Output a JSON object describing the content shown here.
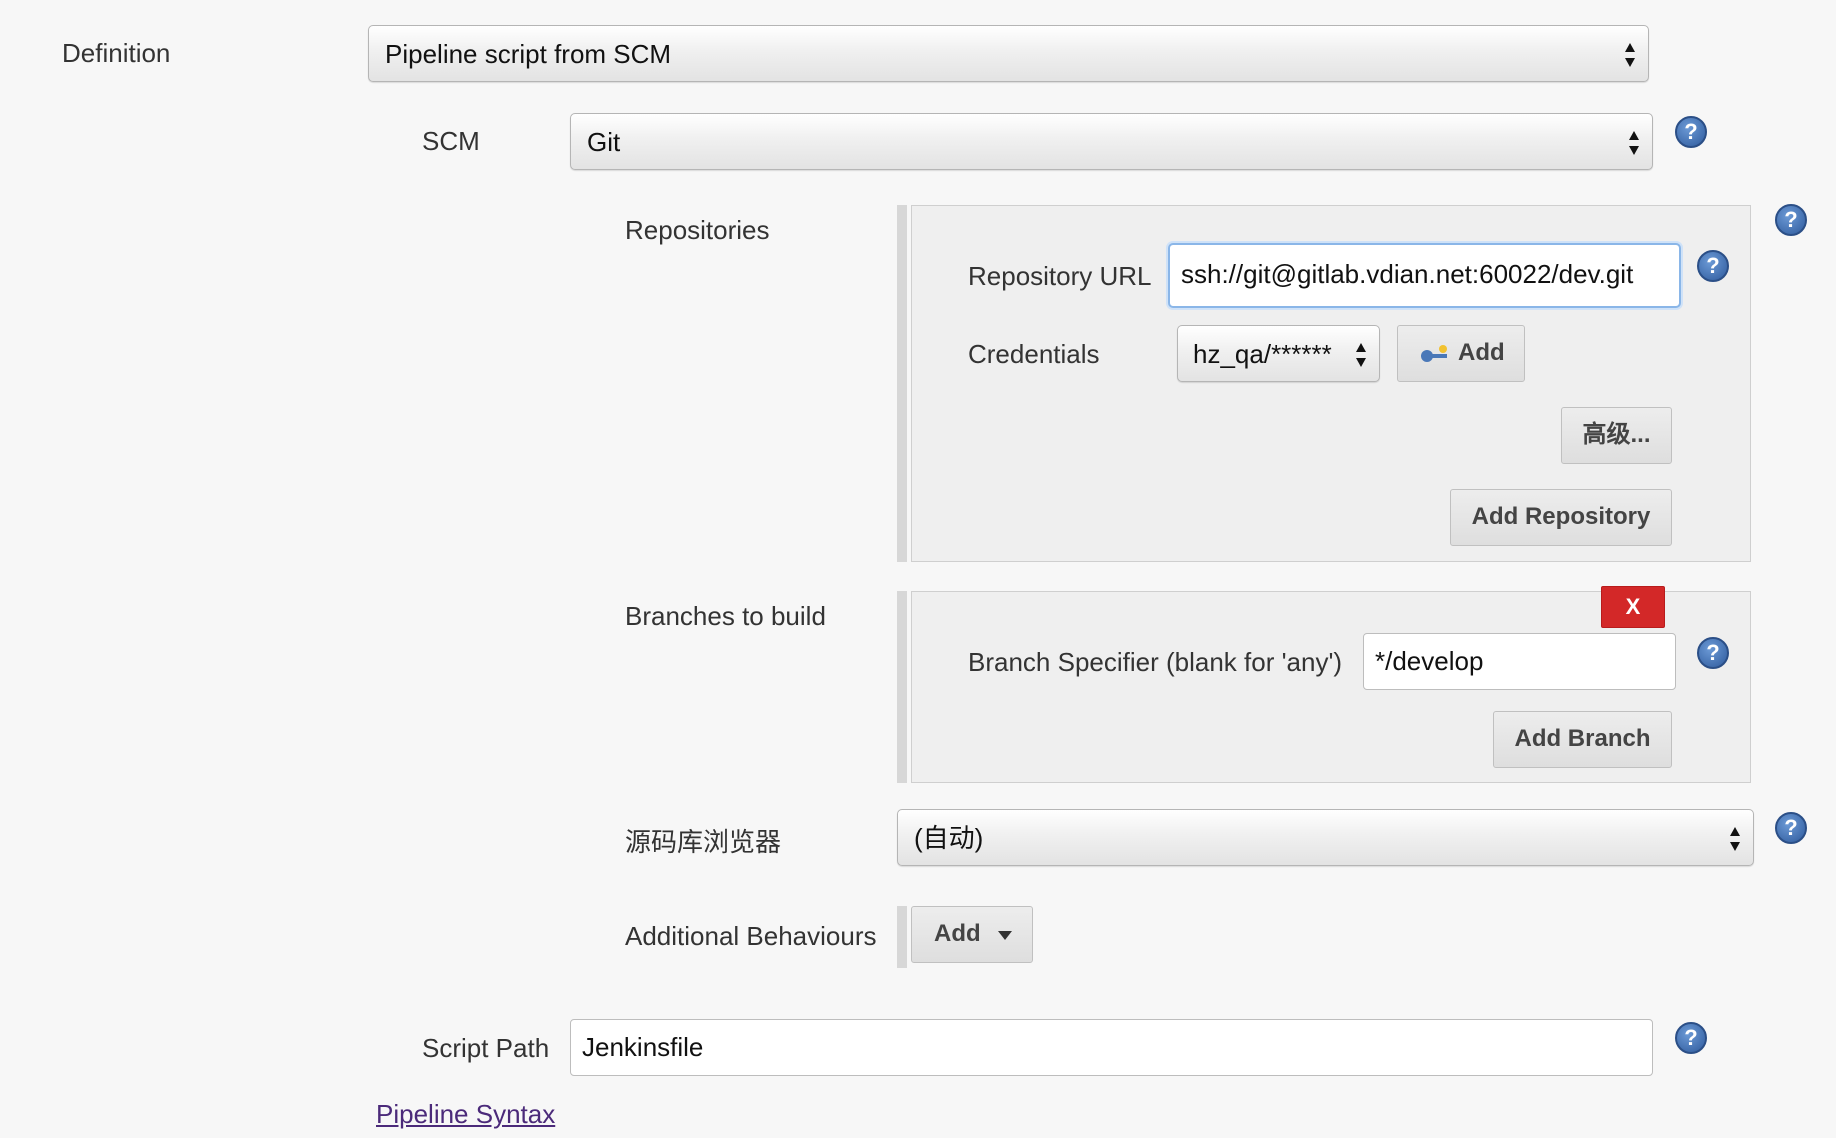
{
  "definition": {
    "label": "Definition",
    "selected": "Pipeline script from SCM"
  },
  "scm": {
    "label": "SCM",
    "selected": "Git"
  },
  "repositories": {
    "label": "Repositories",
    "url_label": "Repository URL",
    "url_value": "ssh://git@gitlab.vdian.net:60022/dev.git",
    "credentials_label": "Credentials",
    "credentials_selected": "hz_qa/******",
    "add_credentials_label": "Add",
    "advanced_label": "高级...",
    "add_repository_label": "Add Repository"
  },
  "branches": {
    "label": "Branches to build",
    "delete_label": "X",
    "specifier_label": "Branch Specifier (blank for 'any')",
    "specifier_value": "*/develop",
    "add_branch_label": "Add Branch"
  },
  "browser": {
    "label": "源码库浏览器",
    "selected": "(自动)"
  },
  "behaviours": {
    "label": "Additional Behaviours",
    "add_label": "Add"
  },
  "script_path": {
    "label": "Script Path",
    "value": "Jenkinsfile"
  },
  "pipeline_syntax_link": "Pipeline Syntax",
  "colors": {
    "background": "#f7f7f7",
    "help_icon": "#2e5a9c",
    "delete_button": "#d32828",
    "focus_border": "#8ab6e8",
    "link": "#4b2a7a"
  },
  "icons": [
    "updown-arrows-icon",
    "help-icon",
    "key-icon",
    "caret-down-icon"
  ]
}
